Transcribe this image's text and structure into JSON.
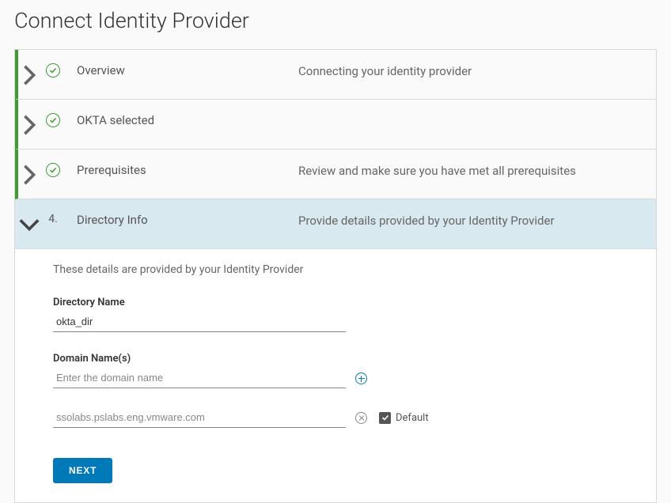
{
  "page": {
    "title": "Connect Identity Provider"
  },
  "steps": [
    {
      "title": "Overview",
      "desc": "Connecting your identity provider"
    },
    {
      "title": "OKTA selected",
      "desc": ""
    },
    {
      "title": "Prerequisites",
      "desc": "Review and make sure you have met all prerequisites"
    },
    {
      "number": "4.",
      "title": "Directory Info",
      "desc": "Provide details provided by your Identity Provider"
    }
  ],
  "panel": {
    "desc": "These details are provided by your Identity Provider",
    "directory_name_label": "Directory Name",
    "directory_name_value": "okta_dir",
    "domain_names_label": "Domain Name(s)",
    "domain_input_placeholder": "Enter the domain name",
    "domain_entries": [
      {
        "value": "ssolabs.pslabs.eng.vmware.com",
        "default": true
      }
    ],
    "default_label": "Default",
    "next_label": "NEXT"
  }
}
